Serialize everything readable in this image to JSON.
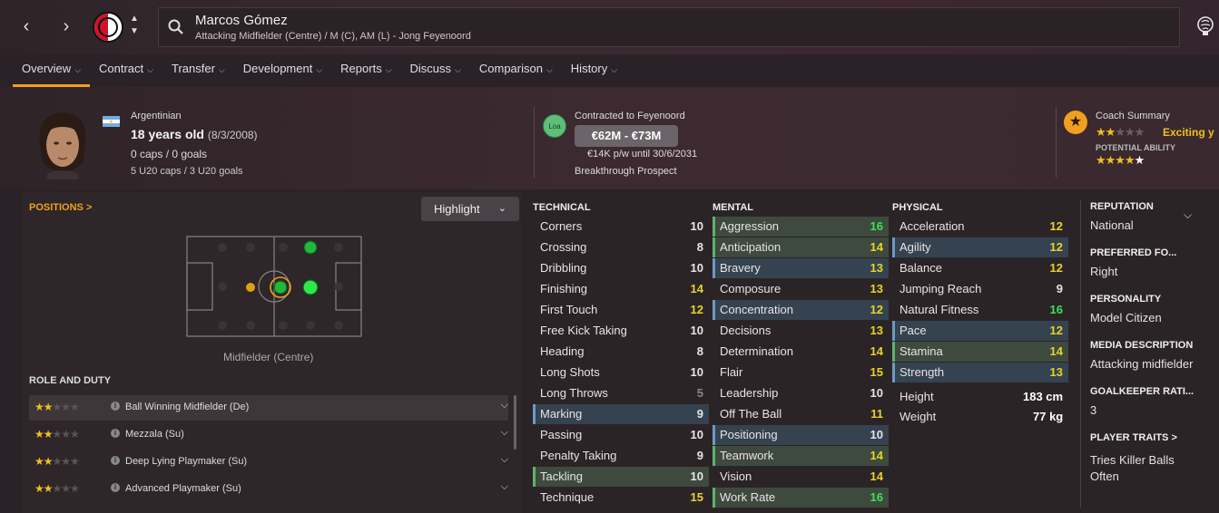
{
  "header": {
    "player_name": "Marcos Gómez",
    "player_desc": "Attacking Midfielder (Centre) / M (C), AM (L) - Jong Feyenoord"
  },
  "tabs": [
    {
      "label": "Overview"
    },
    {
      "label": "Contract"
    },
    {
      "label": "Transfer"
    },
    {
      "label": "Development"
    },
    {
      "label": "Reports"
    },
    {
      "label": "Discuss"
    },
    {
      "label": "Comparison"
    },
    {
      "label": "History"
    }
  ],
  "info": {
    "nationality": "Argentinian",
    "age": "18 years old",
    "dob": "(8/3/2008)",
    "caps": "0 caps / 0 goals",
    "u20": "5 U20 caps / 3 U20 goals"
  },
  "contract": {
    "badge": "Loa",
    "title": "Contracted to Feyenoord",
    "value": "€62M - €73M",
    "wage": "€14K p/w until 30/6/2031",
    "prospect": "Breakthrough Prospect"
  },
  "coach": {
    "title": "Coach Summary",
    "summary": "Exciting y",
    "pa_label": "POTENTIAL ABILITY",
    "current_stars": 2,
    "potential_stars": 4.5
  },
  "positions": {
    "link": "POSITIONS >",
    "highlight": "Highlight",
    "label": "Midfielder (Centre)"
  },
  "roles": {
    "title": "ROLE AND DUTY",
    "items": [
      {
        "name": "Ball Winning Midfielder (De)",
        "stars": 2
      },
      {
        "name": "Mezzala (Su)",
        "stars": 2
      },
      {
        "name": "Deep Lying Playmaker (Su)",
        "stars": 2
      },
      {
        "name": "Advanced Playmaker (Su)",
        "stars": 2
      }
    ]
  },
  "technical": {
    "title": "TECHNICAL",
    "attrs": [
      {
        "name": "Corners",
        "value": "10"
      },
      {
        "name": "Crossing",
        "value": "8"
      },
      {
        "name": "Dribbling",
        "value": "10"
      },
      {
        "name": "Finishing",
        "value": "14"
      },
      {
        "name": "First Touch",
        "value": "12"
      },
      {
        "name": "Free Kick Taking",
        "value": "10"
      },
      {
        "name": "Heading",
        "value": "8"
      },
      {
        "name": "Long Shots",
        "value": "10"
      },
      {
        "name": "Long Throws",
        "value": "5"
      },
      {
        "name": "Marking",
        "value": "9"
      },
      {
        "name": "Passing",
        "value": "10"
      },
      {
        "name": "Penalty Taking",
        "value": "9"
      },
      {
        "name": "Tackling",
        "value": "10"
      },
      {
        "name": "Technique",
        "value": "15"
      }
    ]
  },
  "mental": {
    "title": "MENTAL",
    "attrs": [
      {
        "name": "Aggression",
        "value": "16"
      },
      {
        "name": "Anticipation",
        "value": "14"
      },
      {
        "name": "Bravery",
        "value": "13"
      },
      {
        "name": "Composure",
        "value": "13"
      },
      {
        "name": "Concentration",
        "value": "12"
      },
      {
        "name": "Decisions",
        "value": "13"
      },
      {
        "name": "Determination",
        "value": "14"
      },
      {
        "name": "Flair",
        "value": "15"
      },
      {
        "name": "Leadership",
        "value": "10"
      },
      {
        "name": "Off The Ball",
        "value": "11"
      },
      {
        "name": "Positioning",
        "value": "10"
      },
      {
        "name": "Teamwork",
        "value": "14"
      },
      {
        "name": "Vision",
        "value": "14"
      },
      {
        "name": "Work Rate",
        "value": "16"
      }
    ]
  },
  "physical": {
    "title": "PHYSICAL",
    "attrs": [
      {
        "name": "Acceleration",
        "value": "12"
      },
      {
        "name": "Agility",
        "value": "12"
      },
      {
        "name": "Balance",
        "value": "12"
      },
      {
        "name": "Jumping Reach",
        "value": "9"
      },
      {
        "name": "Natural Fitness",
        "value": "16"
      },
      {
        "name": "Pace",
        "value": "12"
      },
      {
        "name": "Stamina",
        "value": "14"
      },
      {
        "name": "Strength",
        "value": "13"
      }
    ],
    "height_label": "Height",
    "height": "183 cm",
    "weight_label": "Weight",
    "weight": "77 kg"
  },
  "sidebar": {
    "reputation_label": "REPUTATION",
    "reputation": "National",
    "foot_label": "PREFERRED FO...",
    "foot": "Right",
    "personality_label": "PERSONALITY",
    "personality": "Model Citizen",
    "media_label": "MEDIA DESCRIPTION",
    "media": "Attacking midfielder",
    "gk_label": "GOALKEEPER RATI...",
    "gk": "3",
    "traits_label": "PLAYER TRAITS >",
    "traits_1": "Tries Killer Balls",
    "traits_2": "Often"
  },
  "colors": {
    "accent": "#f0a020",
    "good": "#3ee05a",
    "mid": "#e8d428",
    "base": "#e8e4e6",
    "low": "#8a8488"
  }
}
